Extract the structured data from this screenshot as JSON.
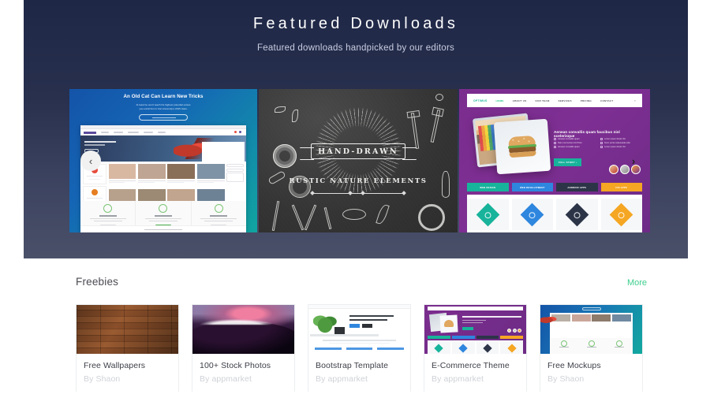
{
  "hero": {
    "title": "Featured Downloads",
    "subtitle": "Featured downloads handpicked by our editors",
    "bg_top": "#1e2746",
    "bg_bottom": "#4a5068",
    "prev_arrow": "‹",
    "next_arrow": "›"
  },
  "carousel": {
    "slides": [
      {
        "name": "cat-university-template",
        "headline": "An Old Cat Can Learn New Tricks",
        "sub_line1": "At least he won't teach his highest potential unless",
        "sub_line2": "you enroll him in Cat University's 2015 class.",
        "button": "LEARN MORE",
        "features": [
          "Courses",
          "Library",
          "Community"
        ],
        "feature_buttons": [
          "Learn",
          "Register",
          "Share"
        ],
        "footer": "Subscribe to Mailing List"
      },
      {
        "name": "hand-drawn-rustic-elements",
        "banner": "HAND-DRAWN",
        "subtitle": "RUSTIC NATURE ELEMENTS"
      },
      {
        "name": "purple-agency-template",
        "logo": "OPTIMUS",
        "nav": [
          "HOME",
          "ABOUT US",
          "OUR TEAM",
          "SERVICES",
          "PRICING",
          "CONTACT"
        ],
        "search_icon": "search-icon",
        "headline": "Aenean convallis quam faucibus nisl scelerisque",
        "bullets": [
          "Aenean convallis quam",
          "Lorem ipsum Dolor Sit",
          "Nam non lectus orci Proin",
          "Nunc porta malesuada odio",
          "Aenean convallis quam",
          "Lorem ipsum Dolor Sit"
        ],
        "cta": "FULL STORY  ›",
        "tabs": [
          {
            "label": "WEB DESIGN",
            "color": "#18b39b"
          },
          {
            "label": "WEB DEVELOPMENT",
            "color": "#2e86de"
          },
          {
            "label": "ANDROID APPS",
            "color": "#2c3548"
          },
          {
            "label": "IOS APPS",
            "color": "#f5a623"
          }
        ]
      }
    ]
  },
  "freebies": {
    "title": "Freebies",
    "more_label": "More",
    "more_color": "#3ecf8e",
    "items": [
      {
        "name": "Free Wallpapers",
        "author": "By Shaon",
        "thumb": "wood-texture"
      },
      {
        "name": "100+ Stock Photos",
        "author": "By appmarket",
        "thumb": "sunset-clouds"
      },
      {
        "name": "Bootstrap Template",
        "author": "By appmarket",
        "thumb": "white-landing-page"
      },
      {
        "name": "E-Commerce Theme",
        "author": "By appmarket",
        "thumb": "purple-template"
      },
      {
        "name": "Free Mockups",
        "author": "By Shaon",
        "thumb": "blue-template"
      }
    ]
  }
}
